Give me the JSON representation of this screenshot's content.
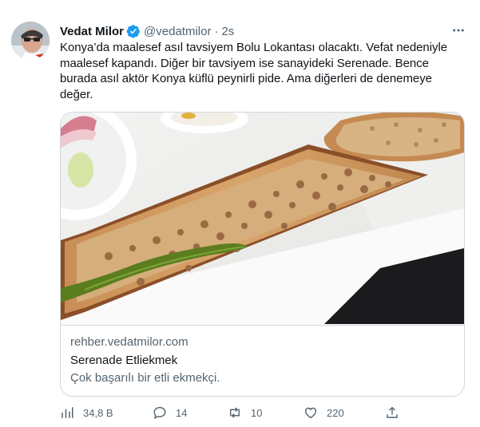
{
  "author": {
    "name": "Vedat Milor",
    "handle": "@vedatmilor",
    "separator": "·",
    "time": "2s"
  },
  "tweet": {
    "line1": "Konya’da maalesef asıl tavsiyem Bolu Lokantası olacaktı. Vefat nedeniyle",
    "line2": "maalesef kapandı. Diğer bir tavsiyem ise sanayideki Serenade. Bence",
    "line3": "burada asıl aktör Konya küflü peynirli pide. Ama diğerleri de denemeye",
    "line4": "değer."
  },
  "card": {
    "domain": "rehber.vedatmilor.com",
    "title": "Serenade Etliekmek",
    "description": "Çok başarılı bir etli ekmekçi."
  },
  "actions": {
    "views": "34,8 B",
    "replies": "14",
    "retweets": "10",
    "likes": "220"
  },
  "icons": [
    "avatar",
    "verified-badge-icon",
    "more-options-icon",
    "views-chart-icon",
    "reply-icon",
    "retweet-icon",
    "like-icon",
    "share-icon"
  ],
  "colors": {
    "verified": "#1d9bf0",
    "secondary_text": "#536471",
    "border": "#cfd9de"
  }
}
